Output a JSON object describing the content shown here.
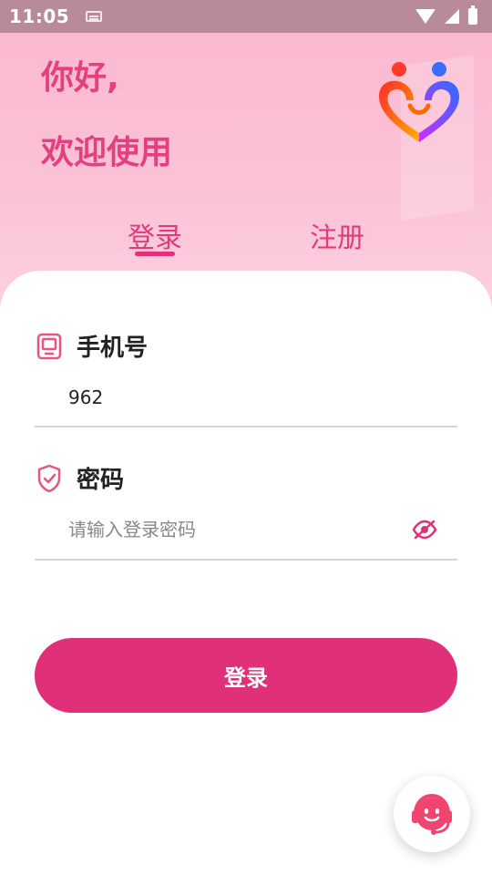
{
  "status_bar": {
    "time": "11:05",
    "icons": [
      "keyboard-icon",
      "wifi-icon",
      "signal-icon",
      "battery-icon"
    ]
  },
  "header": {
    "greeting_line1": "你好,",
    "greeting_line2": "欢迎使用",
    "logo_icon": "heart-people-logo",
    "tabs": [
      {
        "label": "登录",
        "active": true
      },
      {
        "label": "注册",
        "active": false
      }
    ]
  },
  "form": {
    "phone": {
      "label": "手机号",
      "icon": "phone-icon",
      "value": "962"
    },
    "password": {
      "label": "密码",
      "icon": "shield-icon",
      "placeholder": "请输入登录密码",
      "toggle_icon": "eye-off-icon"
    },
    "submit_label": "登录"
  },
  "support": {
    "icon": "customer-service-icon"
  },
  "colors": {
    "accent": "#e0307a",
    "header_bg": "#fbb9d0",
    "status_bar": "#b98a9a"
  }
}
